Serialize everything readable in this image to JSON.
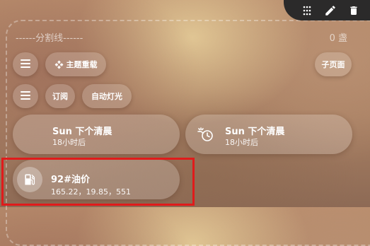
{
  "toolbar": {
    "icons": [
      "drag-handle-icon",
      "pencil-icon",
      "trash-icon"
    ],
    "background": "#2b2a2a"
  },
  "section": {
    "divider_label": "------分割线------",
    "count_label": "0 盏"
  },
  "row1": {
    "menu_icon": "menu-icon",
    "theme_chip": {
      "label": "主题重载",
      "icon": "move-arrows-icon"
    },
    "subpage_chip": {
      "label": "子页面"
    }
  },
  "row2": {
    "menu_icon": "menu-icon",
    "subscribe_chip": {
      "label": "订阅"
    },
    "auto_light_chip": {
      "label": "自动灯光"
    }
  },
  "cards": {
    "sun_left": {
      "title": "Sun 下个清晨",
      "subtitle": "18小时后"
    },
    "sun_right": {
      "title": "Sun 下个清晨",
      "subtitle": "18小时后",
      "icon": "sun-clock-icon"
    },
    "fuel": {
      "title": "92#油价",
      "subtitle": "165.22，19.85，551",
      "icon": "gas-station-icon"
    }
  },
  "colors": {
    "highlight": "#e01b1b",
    "text": "#ffffff"
  }
}
